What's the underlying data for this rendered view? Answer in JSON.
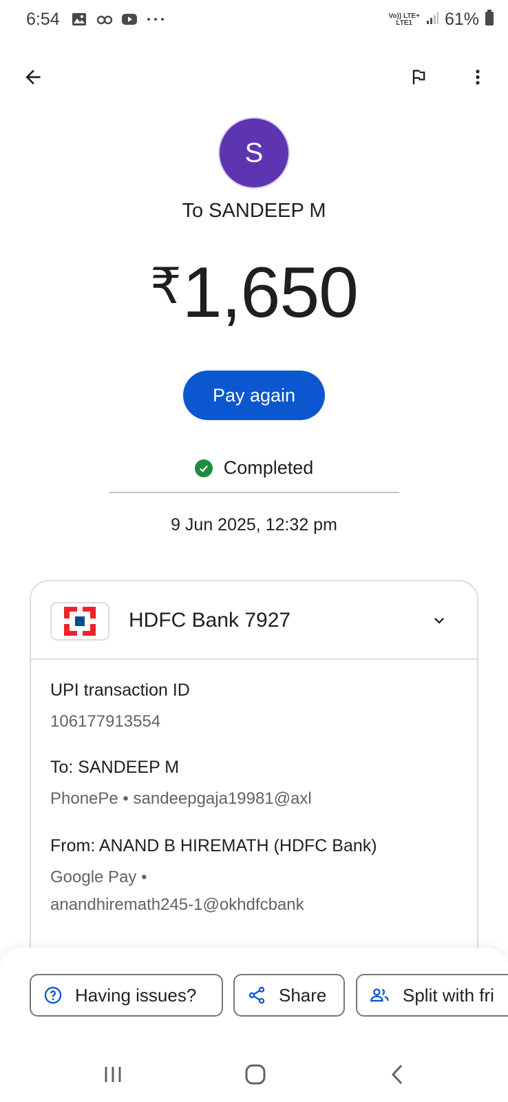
{
  "status_bar": {
    "time": "6:54",
    "network_top": "Vo)) LTE+",
    "network_bottom": "LTE1",
    "battery": "61%"
  },
  "transaction": {
    "avatar_initial": "S",
    "recipient_heading": "To SANDEEP M",
    "currency_symbol": "₹",
    "amount": "1,650",
    "pay_again_label": "Pay again",
    "status": "Completed",
    "datetime": "9 Jun 2025, 12:32 pm"
  },
  "details": {
    "bank_name": "HDFC Bank 7927",
    "upi_label": "UPI transaction ID",
    "upi_id": "106177913554",
    "to_label": "To: SANDEEP M",
    "to_value": "PhonePe • sandeepgaja19981@axl",
    "from_label": "From: ANAND B HIREMATH (HDFC Bank)",
    "from_value_line1": "Google Pay •",
    "from_value_line2": "anandhiremath245-1@okhdfcbank"
  },
  "actions": {
    "issues": "Having issues?",
    "share": "Share",
    "split": "Split with fri"
  },
  "colors": {
    "primary": "#0b57d0",
    "avatar": "#5e35b1",
    "success": "#1e8e3e",
    "hdfc_red": "#ed232a",
    "hdfc_blue": "#004c8f"
  }
}
